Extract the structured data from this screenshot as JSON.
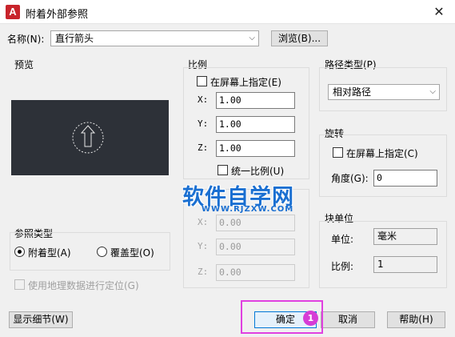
{
  "window": {
    "title": "附着外部参照",
    "close_glyph": "✕",
    "app_icon_letter": "A"
  },
  "name_row": {
    "label": "名称(N):",
    "value": "直行箭头",
    "browse_label": "浏览(B)..."
  },
  "preview": {
    "label": "预览"
  },
  "scale": {
    "label": "比例",
    "on_screen_label": "在屏幕上指定(E)",
    "on_screen_checked": false,
    "x_label": "X:",
    "x_value": "1.00",
    "y_label": "Y:",
    "y_value": "1.00",
    "z_label": "Z:",
    "z_value": "1.00",
    "uniform_label": "统一比例(U)",
    "uniform_checked": false
  },
  "insert_point": {
    "x_label": "X:",
    "x_value": "0.00",
    "y_label": "Y:",
    "y_value": "0.00",
    "z_label": "Z:",
    "z_value": "0.00"
  },
  "path_type": {
    "label": "路径类型(P)",
    "value": "相对路径"
  },
  "rotation": {
    "label": "旋转",
    "on_screen_label": "在屏幕上指定(C)",
    "on_screen_checked": false,
    "angle_label": "角度(G):",
    "angle_value": "0"
  },
  "block_unit": {
    "label": "块单位",
    "unit_label": "单位:",
    "unit_value": "毫米",
    "factor_label": "比例:",
    "factor_value": "1"
  },
  "reference_type": {
    "label": "参照类型",
    "attach_label": "附着型(A)",
    "attach_selected": true,
    "overlay_label": "覆盖型(O)",
    "overlay_selected": false
  },
  "geo": {
    "label": "使用地理数据进行定位(G)",
    "checked": false,
    "enabled": false
  },
  "buttons": {
    "details": "显示细节(W)",
    "ok": "确定",
    "cancel": "取消",
    "help": "帮助(H)"
  },
  "annotation": {
    "step_number": "1",
    "highlight_color": "#e040e0"
  },
  "watermark": {
    "text": "软件自学网",
    "sub": "WWW.RJZXW.COM"
  },
  "colors": {
    "app_icon": "#c8242b",
    "preview_bg": "#2d3138",
    "default_button_border": "#0078d7"
  }
}
